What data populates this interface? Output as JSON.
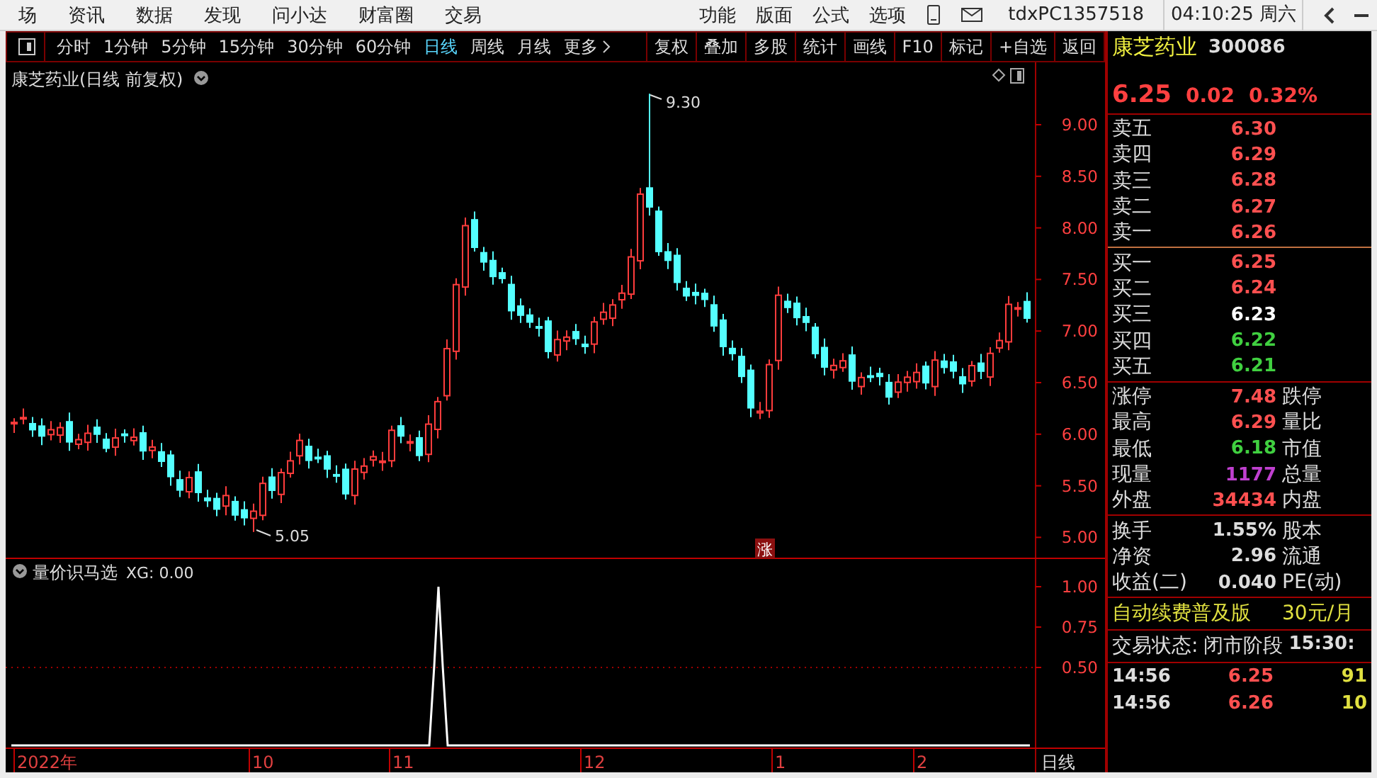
{
  "menu_bar": {
    "items": [
      "场",
      "资讯",
      "数据",
      "发现",
      "问小达",
      "财富圈",
      "交易"
    ],
    "right_items": [
      "功能",
      "版面",
      "公式",
      "选项"
    ],
    "account": "tdxPC1357518",
    "clock": "04:10:25 周六"
  },
  "period_tabs": [
    {
      "label": "分时",
      "selected": false
    },
    {
      "label": "1分钟",
      "selected": false
    },
    {
      "label": "5分钟",
      "selected": false
    },
    {
      "label": "15分钟",
      "selected": false
    },
    {
      "label": "30分钟",
      "selected": false
    },
    {
      "label": "60分钟",
      "selected": false
    },
    {
      "label": "日线",
      "selected": true
    },
    {
      "label": "周线",
      "selected": false
    },
    {
      "label": "月线",
      "selected": false
    },
    {
      "label": "更多",
      "selected": false
    }
  ],
  "tool_buttons": [
    "复权",
    "叠加",
    "多股",
    "统计",
    "画线",
    "F10",
    "标记",
    "+自选",
    "返回"
  ],
  "chart": {
    "title": "康芝药业(日线 前复权)",
    "price_ticks": [
      "9.00",
      "8.50",
      "8.00",
      "7.50",
      "7.00",
      "6.50",
      "6.00",
      "5.50",
      "5.00"
    ],
    "high_label": "9.30",
    "low_label": "5.05",
    "limit_badge": "涨",
    "indicator": {
      "title": "量价识马选",
      "reading": "XG: 0.00",
      "ticks": [
        "1.00",
        "0.75",
        "0.50"
      ]
    },
    "date_labels": [
      "2022年",
      "10",
      "11",
      "12",
      "1",
      "2"
    ],
    "period_label": "日线"
  },
  "quote": {
    "name": "康芝药业",
    "code": "300086",
    "price": "6.25",
    "change": "0.02",
    "change_pct": "0.32%",
    "asks": [
      {
        "label": "卖五",
        "price": "6.30",
        "color": "#ff5050"
      },
      {
        "label": "卖四",
        "price": "6.29",
        "color": "#ff5050"
      },
      {
        "label": "卖三",
        "price": "6.28",
        "color": "#ff5050"
      },
      {
        "label": "卖二",
        "price": "6.27",
        "color": "#ff5050"
      },
      {
        "label": "卖一",
        "price": "6.26",
        "color": "#ff5050"
      }
    ],
    "bids": [
      {
        "label": "买一",
        "price": "6.25",
        "color": "#ff5050"
      },
      {
        "label": "买二",
        "price": "6.24",
        "color": "#ff5050"
      },
      {
        "label": "买三",
        "price": "6.23",
        "color": "#ffffff"
      },
      {
        "label": "买四",
        "price": "6.22",
        "color": "#40d040"
      },
      {
        "label": "买五",
        "price": "6.21",
        "color": "#40d040"
      }
    ],
    "stats": [
      {
        "label": "涨停",
        "value": "7.48",
        "label_2": "跌停",
        "color": "#ff5050"
      },
      {
        "label": "最高",
        "value": "6.29",
        "label_2": "量比",
        "color": "#ff5050"
      },
      {
        "label": "最低",
        "value": "6.18",
        "label_2": "市值",
        "color": "#40d040"
      },
      {
        "label": "现量",
        "value": "1177",
        "label_2": "总量",
        "color": "#c040d0"
      },
      {
        "label": "外盘",
        "value": "34434",
        "label_2": "内盘",
        "color": "#ff5050"
      }
    ],
    "stats_2": [
      {
        "label": "换手",
        "value": "1.55%",
        "label_2": "股本"
      },
      {
        "label": "净资",
        "value": "2.96",
        "label_2": "流通"
      },
      {
        "label": "收益(二)",
        "value": "0.040",
        "label_2": "PE(动)"
      }
    ],
    "promo": {
      "text": "自动续费普及版",
      "price": "30元/月"
    },
    "status": {
      "label": "交易状态:",
      "value": "闭市阶段",
      "time": "15:30:"
    },
    "trades": [
      {
        "time": "14:56",
        "price": "6.25",
        "volume": "91"
      },
      {
        "time": "14:56",
        "price": "6.26",
        "volume": "10"
      }
    ]
  }
}
